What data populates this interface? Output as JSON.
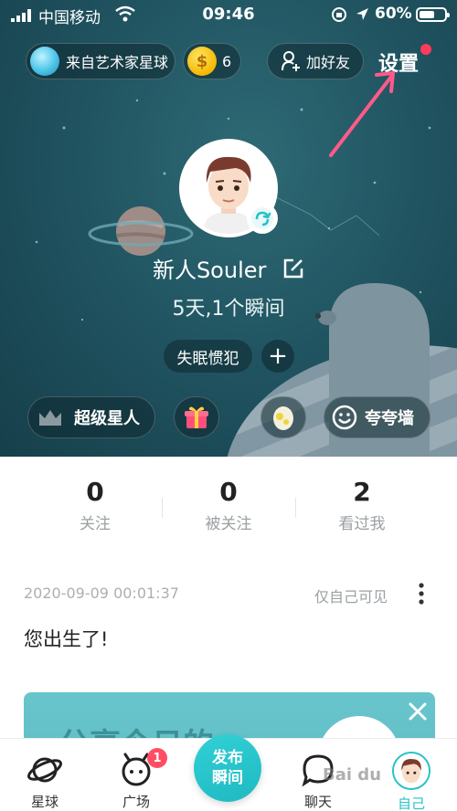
{
  "status_bar": {
    "carrier": "中国移动",
    "time": "09:46",
    "battery_percent": "60%"
  },
  "header": {
    "planet_label": "来自艺术家星球",
    "coin_count": "6",
    "add_friend_label": "加好友",
    "settings_label": "设置"
  },
  "profile": {
    "username": "新人Souler",
    "stats_line": "5天,1个瞬间",
    "tag": "失眠惯犯",
    "tag_add": "+",
    "super_star_label": "超级星人",
    "praise_wall_label": "夸夸墙"
  },
  "counters": [
    {
      "value": "0",
      "label": "关注"
    },
    {
      "value": "0",
      "label": "被关注"
    },
    {
      "value": "2",
      "label": "看过我"
    }
  ],
  "post": {
    "timestamp": "2020-09-09 00:01:37",
    "visibility": "仅自己可见",
    "text": "您出生了!"
  },
  "share_card": {
    "title": "分享今日的"
  },
  "tabbar": {
    "planet": "星球",
    "square": "广场",
    "square_badge": "1",
    "publish": "发布瞬间",
    "chat": "聊天",
    "me": "自己"
  },
  "watermark": "Bai du",
  "colors": {
    "accent": "#25c2c9",
    "hero_background": "#215562",
    "badge": "#ff4d63",
    "annotation_arrow": "#ff5a8a"
  },
  "icons": {
    "settings_dot": "red-dot",
    "arrow": "annotation-arrow-icon"
  }
}
